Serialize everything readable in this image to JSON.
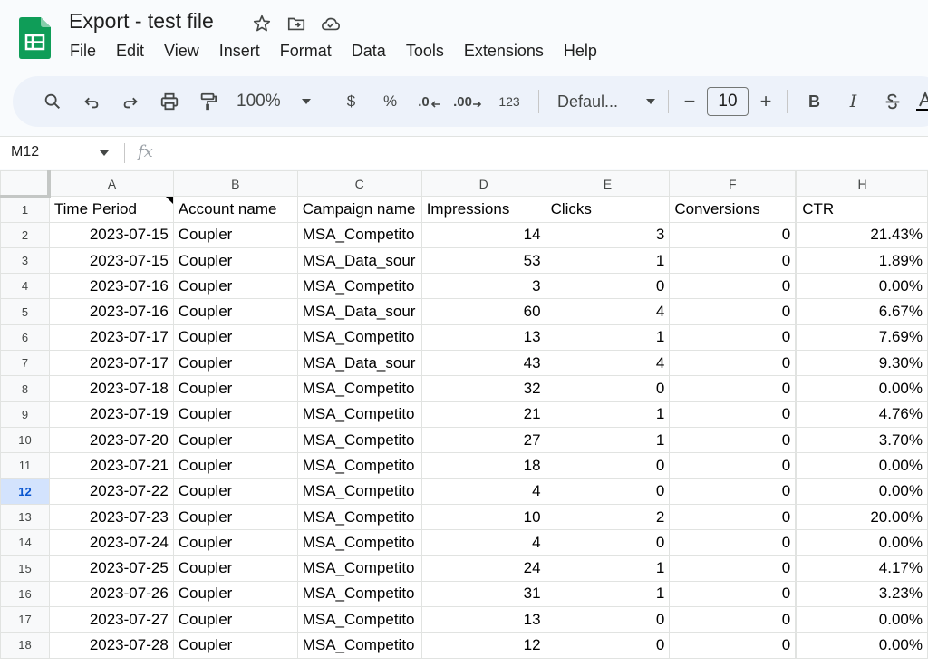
{
  "window": {
    "title": "Export - test file"
  },
  "menu": [
    "File",
    "Edit",
    "View",
    "Insert",
    "Format",
    "Data",
    "Tools",
    "Extensions",
    "Help"
  ],
  "toolbar": {
    "zoom": "100%",
    "currency": "$",
    "percent": "%",
    "decrease_decimal": ".0",
    "increase_decimal": ".00",
    "number_format": "123",
    "font": "Defaul...",
    "font_size": "10",
    "minus": "−",
    "plus": "+",
    "bold": "B",
    "italic": "I"
  },
  "formula": {
    "cell_ref": "M12",
    "fx": "fx",
    "value": ""
  },
  "grid": {
    "columns": [
      "A",
      "B",
      "C",
      "D",
      "E",
      "F",
      "H"
    ],
    "selected_row": 12,
    "header_row": [
      "Time Period",
      "Account name",
      "Campaign name",
      "Impressions",
      "Clicks",
      "Conversions",
      "CTR"
    ],
    "rows": [
      [
        "2023-07-15",
        "Coupler",
        "MSA_Competito",
        "14",
        "3",
        "0",
        "21.43%"
      ],
      [
        "2023-07-15",
        "Coupler",
        "MSA_Data_sour",
        "53",
        "1",
        "0",
        "1.89%"
      ],
      [
        "2023-07-16",
        "Coupler",
        "MSA_Competito",
        "3",
        "0",
        "0",
        "0.00%"
      ],
      [
        "2023-07-16",
        "Coupler",
        "MSA_Data_sour",
        "60",
        "4",
        "0",
        "6.67%"
      ],
      [
        "2023-07-17",
        "Coupler",
        "MSA_Competito",
        "13",
        "1",
        "0",
        "7.69%"
      ],
      [
        "2023-07-17",
        "Coupler",
        "MSA_Data_sour",
        "43",
        "4",
        "0",
        "9.30%"
      ],
      [
        "2023-07-18",
        "Coupler",
        "MSA_Competito",
        "32",
        "0",
        "0",
        "0.00%"
      ],
      [
        "2023-07-19",
        "Coupler",
        "MSA_Competito",
        "21",
        "1",
        "0",
        "4.76%"
      ],
      [
        "2023-07-20",
        "Coupler",
        "MSA_Competito",
        "27",
        "1",
        "0",
        "3.70%"
      ],
      [
        "2023-07-21",
        "Coupler",
        "MSA_Competito",
        "18",
        "0",
        "0",
        "0.00%"
      ],
      [
        "2023-07-22",
        "Coupler",
        "MSA_Competito",
        "4",
        "0",
        "0",
        "0.00%"
      ],
      [
        "2023-07-23",
        "Coupler",
        "MSA_Competito",
        "10",
        "2",
        "0",
        "20.00%"
      ],
      [
        "2023-07-24",
        "Coupler",
        "MSA_Competito",
        "4",
        "0",
        "0",
        "0.00%"
      ],
      [
        "2023-07-25",
        "Coupler",
        "MSA_Competito",
        "24",
        "1",
        "0",
        "4.17%"
      ],
      [
        "2023-07-26",
        "Coupler",
        "MSA_Competito",
        "31",
        "1",
        "0",
        "3.23%"
      ],
      [
        "2023-07-27",
        "Coupler",
        "MSA_Competito",
        "13",
        "0",
        "0",
        "0.00%"
      ],
      [
        "2023-07-28",
        "Coupler",
        "MSA_Competito",
        "12",
        "0",
        "0",
        "0.00%"
      ]
    ]
  },
  "colors": {
    "brand": "#0f9d58",
    "toolbar_bg": "#edf2fa",
    "selected_header": "#d3e3fd"
  }
}
